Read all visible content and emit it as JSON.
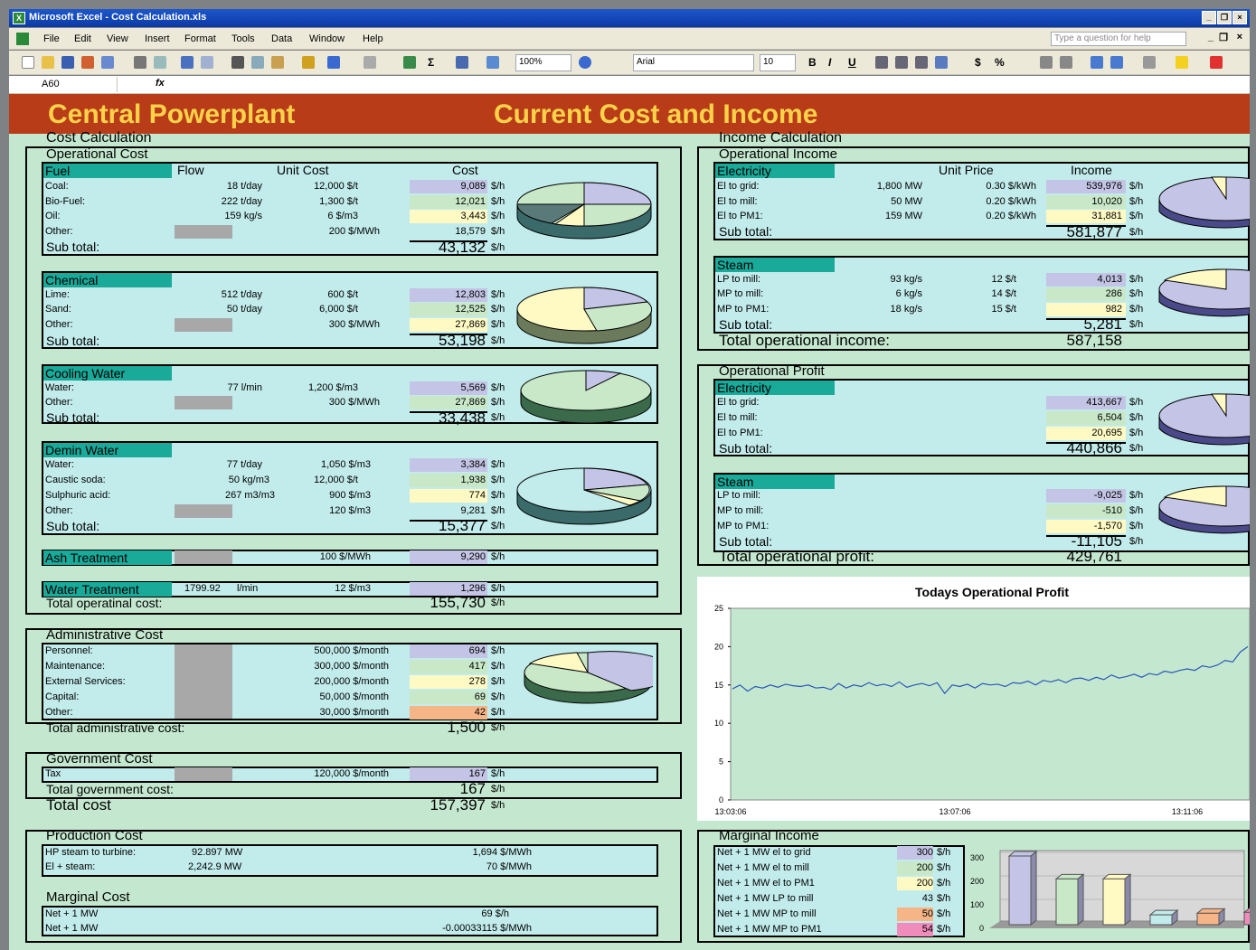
{
  "window": {
    "title": "Microsoft Excel - Cost Calculation.xls"
  },
  "menu": [
    "File",
    "Edit",
    "View",
    "Insert",
    "Format",
    "Tools",
    "Data",
    "Window",
    "Help"
  ],
  "help_placeholder": "Type a question for help",
  "toolbar": {
    "zoom": "100%",
    "font": "Arial",
    "size": "10",
    "bold": "B",
    "italic": "I",
    "underline": "U",
    "currency": "$",
    "percent": "%"
  },
  "namebox": "A60",
  "fx": "fx",
  "banner": {
    "left": "Central Powerplant",
    "right": "Current Cost and Income"
  },
  "cost": {
    "title": "Cost Calculation",
    "op_title": "Operational Cost",
    "fuel": {
      "hdr": "Fuel",
      "col_flow": "Flow",
      "col_unit": "Unit Cost",
      "col_cost": "Cost",
      "rows": [
        {
          "n": "Coal:",
          "f": "18 t/day",
          "u": "12,000 $/t",
          "c": "9,089",
          "cu": "$/h"
        },
        {
          "n": "Bio-Fuel:",
          "f": "222 t/day",
          "u": "1,300 $/t",
          "c": "12,021",
          "cu": "$/h"
        },
        {
          "n": "Oil:",
          "f": "159 kg/s",
          "u": "6 $/m3",
          "c": "3,443",
          "cu": "$/h"
        },
        {
          "n": "Other:",
          "f": "",
          "u": "200 $/MWh",
          "c": "18,579",
          "cu": "$/h"
        }
      ],
      "sub": "Sub total:",
      "subv": "43,132",
      "subu": "$/h"
    },
    "chem": {
      "hdr": "Chemical",
      "rows": [
        {
          "n": "Lime:",
          "f": "512 t/day",
          "u": "600 $/t",
          "c": "12,803",
          "cu": "$/h"
        },
        {
          "n": "Sand:",
          "f": "50 t/day",
          "u": "6,000 $/t",
          "c": "12,525",
          "cu": "$/h"
        },
        {
          "n": "Other:",
          "f": "",
          "u": "300 $/MWh",
          "c": "27,869",
          "cu": "$/h"
        }
      ],
      "sub": "Sub total:",
      "subv": "53,198",
      "subu": "$/h"
    },
    "cool": {
      "hdr": "Cooling Water",
      "rows": [
        {
          "n": "Water:",
          "f": "77 l/min",
          "u": "1,200 $/m3",
          "c": "5,569",
          "cu": "$/h"
        },
        {
          "n": "Other:",
          "f": "",
          "u": "300 $/MWh",
          "c": "27,869",
          "cu": "$/h"
        }
      ],
      "sub": "Sub total:",
      "subv": "33,438",
      "subu": "$/h"
    },
    "demin": {
      "hdr": "Demin Water",
      "rows": [
        {
          "n": "Water:",
          "f": "77 t/day",
          "u": "1,050 $/m3",
          "c": "3,384",
          "cu": "$/h"
        },
        {
          "n": "Caustic soda:",
          "f": "50 kg/m3",
          "u": "12,000 $/t",
          "c": "1,938",
          "cu": "$/h"
        },
        {
          "n": "Sulphuric acid:",
          "f": "267 m3/m3",
          "u": "900 $/m3",
          "c": "774",
          "cu": "$/h"
        },
        {
          "n": "Other:",
          "f": "",
          "u": "120 $/m3",
          "c": "9,281",
          "cu": "$/h"
        }
      ],
      "sub": "Sub total:",
      "subv": "15,377",
      "subu": "$/h"
    },
    "ash": {
      "hdr": "Ash Treatment",
      "u": "100 $/MWh",
      "c": "9,290",
      "cu": "$/h"
    },
    "water": {
      "hdr": "Water Treatment",
      "f": "1799.92",
      "fu": "l/min",
      "u": "12 $/m3",
      "c": "1,296",
      "cu": "$/h"
    },
    "total_op": "Total operatinal cost:",
    "total_opv": "155,730",
    "total_opu": "$/h",
    "admin": {
      "title": "Administrative Cost",
      "rows": [
        {
          "n": "Personnel:",
          "u": "500,000 $/month",
          "c": "694",
          "cu": "$/h"
        },
        {
          "n": "Maintenance:",
          "u": "300,000 $/month",
          "c": "417",
          "cu": "$/h"
        },
        {
          "n": "External Services:",
          "u": "200,000 $/month",
          "c": "278",
          "cu": "$/h"
        },
        {
          "n": "Capital:",
          "u": "50,000 $/month",
          "c": "69",
          "cu": "$/h"
        },
        {
          "n": "Other:",
          "u": "30,000 $/month",
          "c": "42",
          "cu": "$/h"
        }
      ],
      "total": "Total administrative cost:",
      "totalv": "1,500",
      "totalu": "$/h"
    },
    "gov": {
      "title": "Government Cost",
      "row": {
        "n": "Tax",
        "u": "120,000 $/month",
        "c": "167",
        "cu": "$/h"
      },
      "total": "Total government cost:",
      "totalv": "167",
      "totalu": "$/h"
    },
    "total": "Total cost",
    "totalv": "157,397",
    "totalu": "$/h"
  },
  "prod": {
    "title": "Production Cost",
    "rows": [
      {
        "n": "HP steam to turbine:",
        "f": "92.897 MW",
        "c": "1,694 $/MWh"
      },
      {
        "n": "El + steam:",
        "f": "2,242.9 MW",
        "c": "70 $/MWh"
      }
    ]
  },
  "marg": {
    "title": "Marginal Cost",
    "rows": [
      {
        "n": "Net + 1 MW",
        "c": "69 $/h"
      },
      {
        "n": "Net + 1 MW",
        "c": "-0.00033115 $/MWh"
      }
    ]
  },
  "income": {
    "title": "Income Calculation",
    "op_title": "Operational Income",
    "elec": {
      "hdr": "Electricity",
      "col_unit": "Unit Price",
      "col_inc": "Income",
      "rows": [
        {
          "n": "El to grid:",
          "f": "1,800 MW",
          "u": "0.30 $/kWh",
          "c": "539,976",
          "cu": "$/h"
        },
        {
          "n": "El to mill:",
          "f": "50 MW",
          "u": "0.20 $/kWh",
          "c": "10,020",
          "cu": "$/h"
        },
        {
          "n": "El to PM1:",
          "f": "159 MW",
          "u": "0.20 $/kWh",
          "c": "31,881",
          "cu": "$/h"
        }
      ],
      "sub": "Sub total:",
      "subv": "581,877",
      "subu": "$/h"
    },
    "steam": {
      "hdr": "Steam",
      "rows": [
        {
          "n": "LP to mill:",
          "f": "93 kg/s",
          "u": "12 $/t",
          "c": "4,013",
          "cu": "$/h"
        },
        {
          "n": "MP to mill:",
          "f": "6 kg/s",
          "u": "14 $/t",
          "c": "286",
          "cu": "$/h"
        },
        {
          "n": "MP to PM1:",
          "f": "18 kg/s",
          "u": "15 $/t",
          "c": "982",
          "cu": "$/h"
        }
      ],
      "sub": "Sub total:",
      "subv": "5,281",
      "subu": "$/h"
    },
    "total": "Total operational income:",
    "totalv": "587,158"
  },
  "profit": {
    "title": "Operational Profit",
    "elec": {
      "hdr": "Electricity",
      "rows": [
        {
          "n": "El to grid:",
          "c": "413,667",
          "cu": "$/h"
        },
        {
          "n": "El to mill:",
          "c": "6,504",
          "cu": "$/h"
        },
        {
          "n": "El to PM1:",
          "c": "20,695",
          "cu": "$/h"
        }
      ],
      "sub": "Sub total:",
      "subv": "440,866",
      "subu": "$/h"
    },
    "steam": {
      "hdr": "Steam",
      "rows": [
        {
          "n": "LP to mill:",
          "c": "-9,025",
          "cu": "$/h"
        },
        {
          "n": "MP to mill:",
          "c": "-510",
          "cu": "$/h"
        },
        {
          "n": "MP to PM1:",
          "c": "-1,570",
          "cu": "$/h"
        }
      ],
      "sub": "Sub total:",
      "subv": "-11,105",
      "subu": "$/h"
    },
    "total": "Total operational profit:",
    "totalv": "429,761"
  },
  "mi": {
    "title": "Marginal Income",
    "rows": [
      {
        "n": "Net + 1 MW el to grid",
        "c": "300",
        "cu": "$/h"
      },
      {
        "n": "Net + 1 MW el to mill",
        "c": "200",
        "cu": "$/h"
      },
      {
        "n": "Net + 1 MW el to PM1",
        "c": "200",
        "cu": "$/h"
      },
      {
        "n": "Net + 1 MW LP to mill",
        "c": "43",
        "cu": "$/h"
      },
      {
        "n": "Net + 1 MW MP to mill",
        "c": "50",
        "cu": "$/h"
      },
      {
        "n": "Net + 1 MW MP to PM1",
        "c": "54",
        "cu": "$/h"
      }
    ]
  },
  "chart_data": [
    {
      "type": "line",
      "title": "Todays Operational Profit",
      "ylim": [
        0,
        25
      ],
      "yticks": [
        "0",
        "5",
        "10",
        "15",
        "20",
        "25"
      ],
      "xticks": [
        "13:03:06",
        "13:07:06",
        "13:11:06"
      ],
      "series": [
        {
          "values": [
            14.5,
            15,
            14.2,
            14.8,
            14.6,
            15,
            14.7,
            15.1,
            14.9,
            14.8,
            15,
            14.6,
            14.7,
            14.4,
            15.2,
            14.6,
            15,
            14.8,
            15.3,
            14.9,
            15.1,
            14.8,
            15.4,
            14.7,
            15,
            15.2,
            14.9,
            15.3,
            13.9,
            15,
            14.8,
            15.1,
            14.6,
            15.2,
            15,
            15.1,
            14.8,
            15.3,
            15.2,
            15.5,
            15,
            15.6,
            15.4,
            15.7,
            15.3,
            15.8,
            15.9,
            15.6,
            16,
            15.7,
            16.3,
            15.9,
            16.1,
            16.4,
            16,
            16.5,
            16.3,
            16.8,
            16.6,
            16.9,
            17.1,
            16.9,
            17.5,
            17.3,
            17.6,
            18.2,
            18,
            19.3,
            20
          ]
        }
      ]
    },
    {
      "type": "bar",
      "categories": [
        "el to grid",
        "el to mill",
        "el to PM1",
        "LP to mill",
        "MP to mill",
        "MP to PM1"
      ],
      "values": [
        300,
        200,
        200,
        43,
        50,
        54
      ],
      "yticks": [
        "0",
        "100",
        "200",
        "300"
      ],
      "ylim": [
        0,
        300
      ],
      "colors": [
        "#c4c4e6",
        "#c8e8c8",
        "#fffac4",
        "#c2ebeb",
        "#f6b586",
        "#f08cbc"
      ]
    }
  ]
}
